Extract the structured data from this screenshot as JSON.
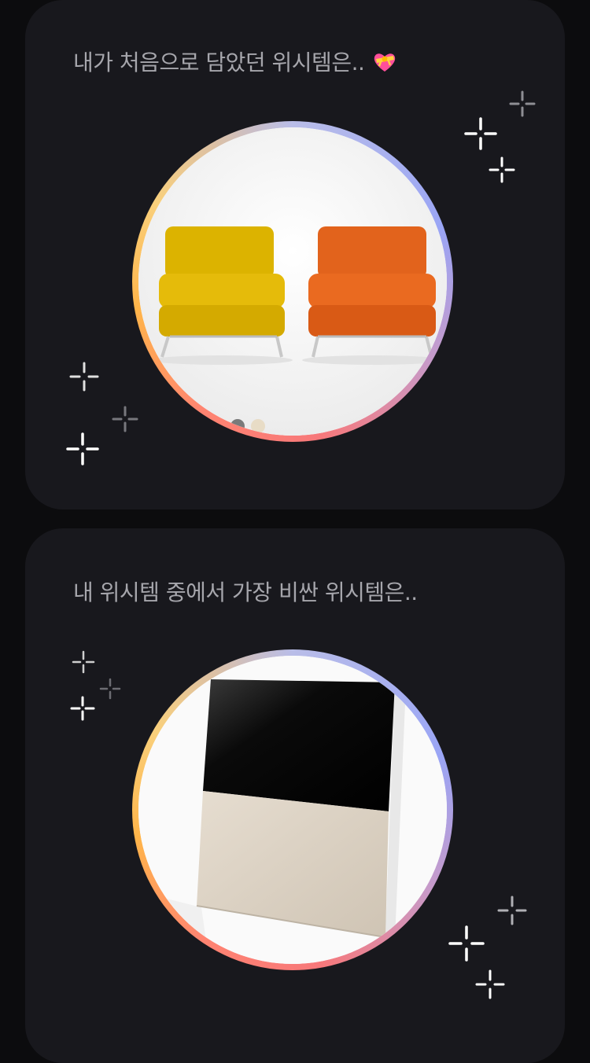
{
  "cards": [
    {
      "title": "내가 처음으로 담았던 위시템은..",
      "title_emoji": "heart-with-ribbon-icon",
      "image": "two-lounge-chairs-yellow-orange"
    },
    {
      "title": "내 위시템 중에서 가장 비싼 위시템은..",
      "image": "easel-tv-beige-cover"
    }
  ],
  "colors": {
    "background": "#0c0c0e",
    "card": "#18181d",
    "title_text": "#a6a6ac",
    "ring_gradient": [
      "#b9bde8",
      "#9aa5f5",
      "#f7787a",
      "#ffb54a",
      "#f9d07c"
    ]
  }
}
